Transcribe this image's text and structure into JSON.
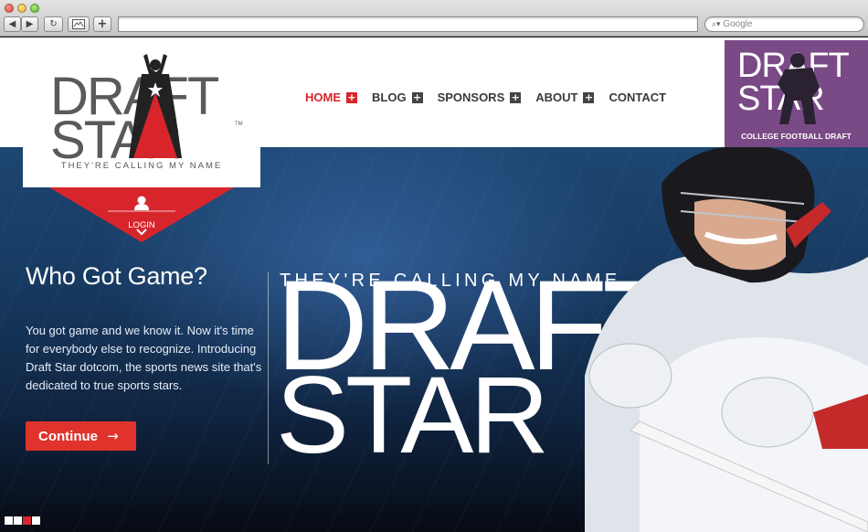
{
  "browser": {
    "search_placeholder": "Google",
    "back": "◀",
    "forward": "▶",
    "reload": "↻",
    "add": "+"
  },
  "site": {
    "logo_word_top": "DRAFT",
    "logo_word_bottom": "STAR",
    "logo_trademark": "TM",
    "tagline": "THEY'RE CALLING MY NAME",
    "login_label": "LOGIN"
  },
  "nav": [
    {
      "label": "HOME",
      "active": true,
      "has_submenu": true
    },
    {
      "label": "BLOG",
      "active": false,
      "has_submenu": true
    },
    {
      "label": "SPONSORS",
      "active": false,
      "has_submenu": true
    },
    {
      "label": "ABOUT",
      "active": false,
      "has_submenu": true
    },
    {
      "label": "CONTACT",
      "active": false,
      "has_submenu": false
    }
  ],
  "hero": {
    "title": "Who Got Game?",
    "body": "You got game and we know it. Now it's time for everybody else to recognize. Introducing Draft Star dotcom, the sports news site that's dedicated to true sports stars.",
    "cta_label": "Continue",
    "cta_arrow": "→",
    "slogan": "THEY'RE CALLING MY NAME",
    "big_word_top": "DRAFT",
    "big_word_bottom": "STAR",
    "slides": [
      false,
      false,
      true,
      false
    ]
  },
  "ad": {
    "word_top": "DRAFT",
    "word_bottom": "STAR",
    "caption": "COLLEGE FOOTBALL DRAFT"
  },
  "colors": {
    "accent_red": "#d8252c",
    "cta_red": "#e0332c",
    "logo_gray": "#5a5a5a",
    "ad_purple": "#7a4a86",
    "hero_blue": "#173a61"
  },
  "icons": [
    "back-arrow-icon",
    "forward-arrow-icon",
    "reload-icon",
    "bookmark-icon",
    "add-tab-icon",
    "search-icon",
    "user-icon",
    "chevron-down-icon",
    "star-icon"
  ]
}
